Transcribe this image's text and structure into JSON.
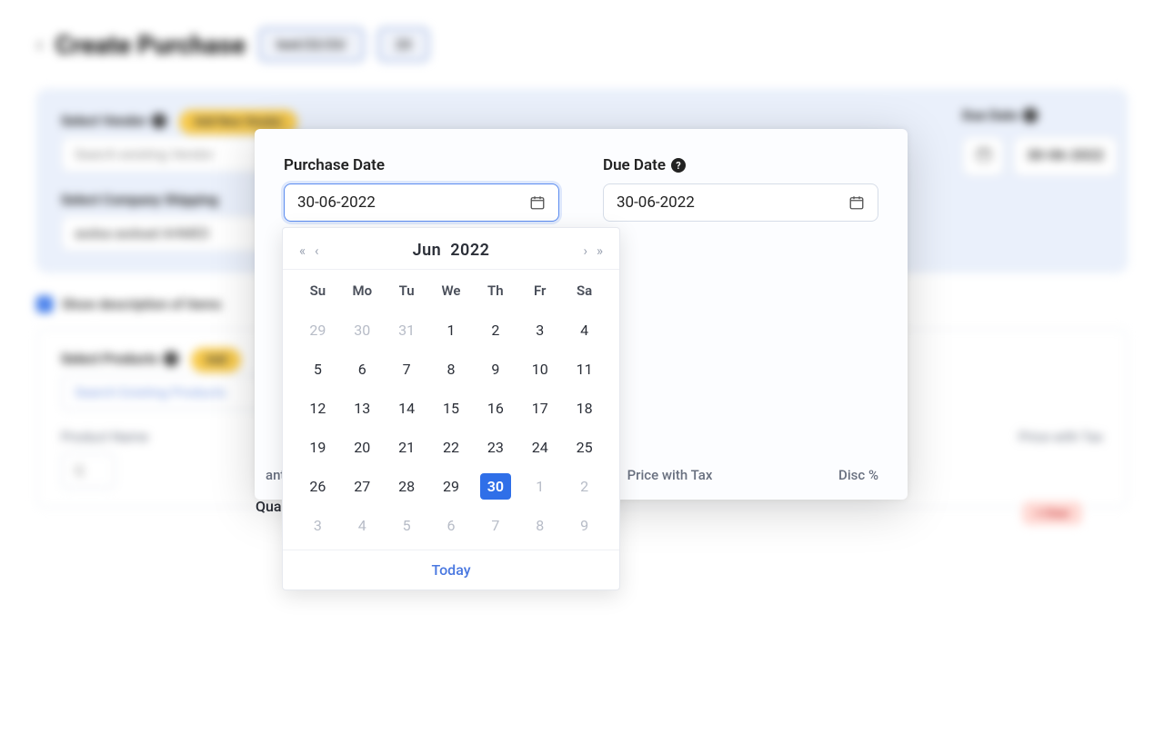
{
  "page": {
    "title": "Create Purchase",
    "tag1": "text/22/23/",
    "tag2": "23"
  },
  "bg": {
    "select_vendor_label": "Select Vendor",
    "add_new": "Add New Vendor",
    "vendor_placeholder": "Search existing Vendor",
    "due_date_label": "Due Date",
    "due_date_value": "30-06-2022",
    "shipping_label": "Select Company Shipping",
    "shipping_value": "asdsa asdsad AHMED",
    "show_desc": "Show description of items",
    "select_products_label": "Select Products",
    "add_prod": "Add",
    "product_placeholder": "Search Existing Products",
    "product_name_col": "Product Name",
    "price_with_tax_col": "Price with Tax",
    "clear": "× Clear",
    "q_placeholder": "Q"
  },
  "modal": {
    "purchase_date_label": "Purchase Date",
    "purchase_date_value": "30-06-2022",
    "due_date_label": "Due Date",
    "due_date_value": "30-06-2022",
    "quantity_label": "Quantity",
    "col_qty": "antity",
    "col_price_tax": "Price with Tax",
    "col_disc": "Disc %"
  },
  "calendar": {
    "month": "Jun",
    "year": "2022",
    "dow": [
      "Su",
      "Mo",
      "Tu",
      "We",
      "Th",
      "Fr",
      "Sa"
    ],
    "today_label": "Today",
    "selected_day": 30,
    "weeks": [
      [
        {
          "n": 29,
          "m": true
        },
        {
          "n": 30,
          "m": true
        },
        {
          "n": 31,
          "m": true
        },
        {
          "n": 1
        },
        {
          "n": 2
        },
        {
          "n": 3
        },
        {
          "n": 4
        }
      ],
      [
        {
          "n": 5
        },
        {
          "n": 6
        },
        {
          "n": 7
        },
        {
          "n": 8
        },
        {
          "n": 9
        },
        {
          "n": 10
        },
        {
          "n": 11
        }
      ],
      [
        {
          "n": 12
        },
        {
          "n": 13
        },
        {
          "n": 14
        },
        {
          "n": 15
        },
        {
          "n": 16
        },
        {
          "n": 17
        },
        {
          "n": 18
        }
      ],
      [
        {
          "n": 19
        },
        {
          "n": 20
        },
        {
          "n": 21
        },
        {
          "n": 22
        },
        {
          "n": 23
        },
        {
          "n": 24
        },
        {
          "n": 25
        }
      ],
      [
        {
          "n": 26
        },
        {
          "n": 27
        },
        {
          "n": 28
        },
        {
          "n": 29
        },
        {
          "n": 30,
          "sel": true
        },
        {
          "n": 1,
          "m": true
        },
        {
          "n": 2,
          "m": true
        }
      ],
      [
        {
          "n": 3,
          "m": true
        },
        {
          "n": 4,
          "m": true
        },
        {
          "n": 5,
          "m": true
        },
        {
          "n": 6,
          "m": true
        },
        {
          "n": 7,
          "m": true
        },
        {
          "n": 8,
          "m": true
        },
        {
          "n": 9,
          "m": true
        }
      ]
    ]
  }
}
